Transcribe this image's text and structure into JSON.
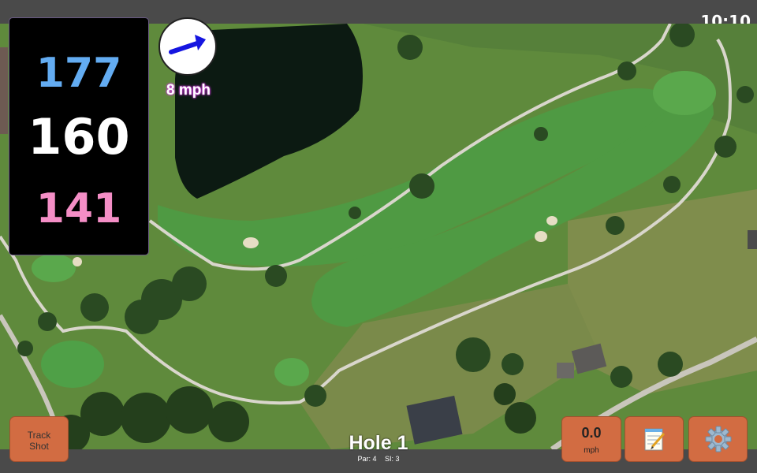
{
  "status_bar": {
    "clock": "10:10"
  },
  "distances": {
    "back": "177",
    "middle": "160",
    "front": "141"
  },
  "wind": {
    "speed": "8 mph",
    "direction": "east-northeast"
  },
  "hole": {
    "title": "Hole 1",
    "par": "Par: 4",
    "stroke_index": "SI: 3"
  },
  "buttons": {
    "track_shot_line1": "Track",
    "track_shot_line2": "Shot",
    "speed_value": "0.0",
    "speed_unit": "mph",
    "notes_icon": "notepad-icon",
    "settings_icon": "gear-icon"
  },
  "colors": {
    "back_distance": "#63acf2",
    "middle_distance": "#ffffff",
    "front_distance": "#f48ec6",
    "button": "#d26c42",
    "wind_arrow": "#1515e0"
  }
}
